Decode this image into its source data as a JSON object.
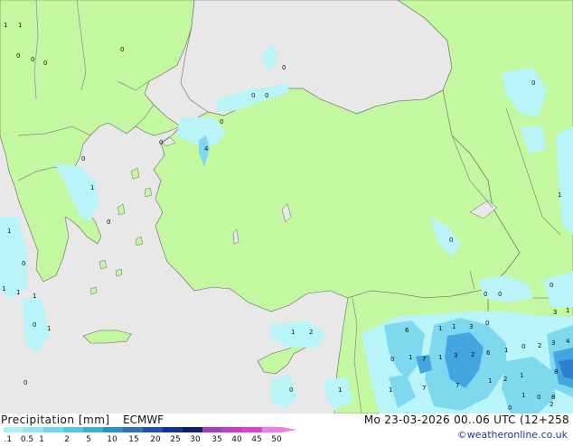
{
  "header": {
    "title": "Precipitation [mm]",
    "model": "ECMWF",
    "valid_time": "Mo 23-03-2026 00..06 UTC (12+258",
    "credit": "©weatheronline.co.uk"
  },
  "legend": {
    "labels": [
      "0.1",
      "0.5",
      "1",
      "2",
      "5",
      "10",
      "15",
      "20",
      "25",
      "30",
      "35",
      "40",
      "45",
      "50"
    ],
    "colors": [
      "#a9f0f8",
      "#8ee6f4",
      "#6fd8ef",
      "#52c8e6",
      "#3aaee0",
      "#2b8fd4",
      "#2a6fc6",
      "#1e4db6",
      "#15309a",
      "#0c1d7a",
      "#a43cc8",
      "#c23ed2",
      "#de3ee0",
      "#f07af0"
    ]
  },
  "map": {
    "colors": {
      "sea": "#e8e8e8",
      "land": "#c3f7a0",
      "border": "#8a8a8a",
      "coast": "#666666",
      "precip_light": "#b8f4f8",
      "precip_mid": "#7fd9ee",
      "precip_heavy": "#43a6df",
      "precip_deep": "#2f7fd0"
    },
    "values": [
      "1",
      "1",
      "0",
      "0",
      "0",
      "0",
      "0",
      "0",
      "0",
      "0",
      "4",
      "0",
      "1",
      "0",
      "0",
      "1",
      "0",
      "1",
      "1",
      "1",
      "1",
      "0",
      "0",
      "0",
      "0",
      "0",
      "0",
      "0",
      "6",
      "1",
      "3",
      "0",
      "1",
      "1",
      "7",
      "1",
      "3",
      "2",
      "6",
      "1",
      "0",
      "2",
      "3",
      "4",
      "7",
      "8",
      "7",
      "2",
      "1",
      "1",
      "1",
      "0",
      "0",
      "3",
      "1",
      "1",
      "1",
      "2",
      "1",
      "0",
      "8",
      "1",
      "0",
      "2"
    ]
  }
}
